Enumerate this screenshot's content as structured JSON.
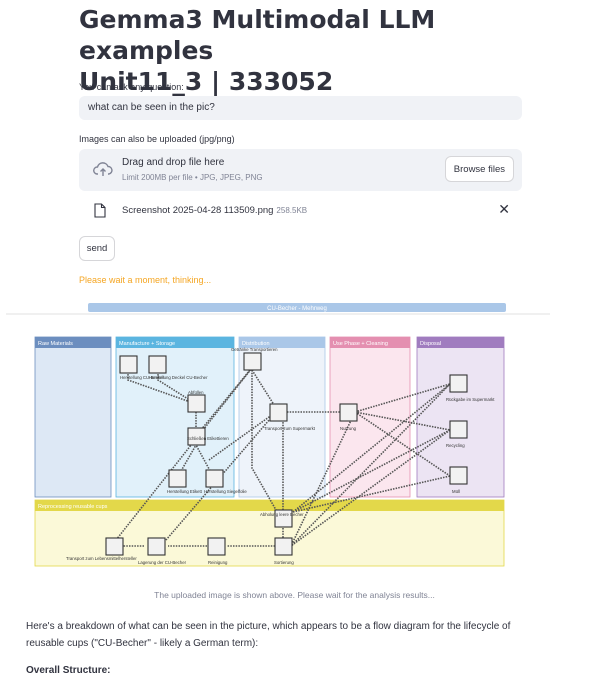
{
  "header": {
    "title_line1": "Gemma3 Multimodal LLM examples",
    "title_line2": "Unit11_3 | 333052"
  },
  "question": {
    "label": "You can ask any question:",
    "value": "what can be seen in the pic?"
  },
  "upload": {
    "label": "Images can also be uploaded  (jpg/png)",
    "drag_title": "Drag and drop file here",
    "drag_subtitle": "Limit 200MB per file • JPG, JPEG, PNG",
    "browse_label": "Browse files",
    "file_name": "Screenshot 2025-04-28 113509.png",
    "file_size": "258.5KB",
    "remove_icon": "close-icon"
  },
  "send_label": "send",
  "status_text": "Please wait a moment, thinking...",
  "diagram": {
    "banner": "CU-Becher - Mehrweg",
    "lanes": [
      {
        "title": "Raw Materials",
        "color": "#6c8ebf"
      },
      {
        "title": "Manufacture + Storage",
        "color": "#5bb5e0"
      },
      {
        "title": "Distribution",
        "color": "#aac7e8"
      },
      {
        "title": "Use Phase + Cleaning",
        "color": "#e48fb0"
      },
      {
        "title": "Disposal",
        "color": "#a07cbf"
      }
    ],
    "band_title": "Reprocessing reusable cups",
    "nodes": [
      "Herstellung CU-Becher",
      "Herstellung Deckel CU-Becher",
      "Abfüllen",
      "Schließen Etikettieren",
      "Herstellung Etikett",
      "Herstellung Siegelfolie",
      "Getränke Transportieren",
      "Transport zum Supermarkt",
      "Nutzung",
      "Rückgabe im Supermarkt",
      "Recycling",
      "Müll",
      "Abholung leere Becher",
      "Sortierung",
      "Reinigung",
      "Lagerung der CU-Becher",
      "Transport zum Lebensmittelhersteller"
    ]
  },
  "caption": "The uploaded image is shown above. Please wait for the analysis results...",
  "response": {
    "paragraph": "Here's a breakdown of what can be seen in the picture, which appears to be a flow diagram for the lifecycle of reusable cups (\"CU-Becher\" - likely a German term):",
    "heading": "Overall Structure:"
  }
}
